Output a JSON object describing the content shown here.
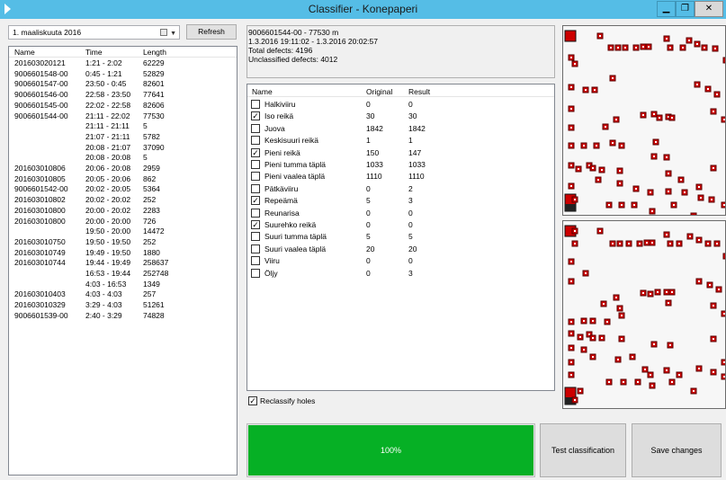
{
  "window": {
    "title": "Classifier - Konepaperi"
  },
  "controls": {
    "minimize": "▁",
    "maximize": "❐",
    "close": "✕",
    "date_value": "1. maaliskuuta 2016",
    "refresh_label": "Refresh"
  },
  "sessions": {
    "headers": {
      "name": "Name",
      "time": "Time",
      "length": "Length"
    },
    "rows": [
      {
        "name": "201603020121",
        "time": "1:21 - 2:02",
        "length": "62229"
      },
      {
        "name": "9006601548-00",
        "time": "0:45 - 1:21",
        "length": "52829"
      },
      {
        "name": "9006601547-00",
        "time": "23:50 - 0:45",
        "length": "82601"
      },
      {
        "name": "9006601546-00",
        "time": "22:58 - 23:50",
        "length": "77641"
      },
      {
        "name": "9006601545-00",
        "time": "22:02 - 22:58",
        "length": "82606"
      },
      {
        "name": "9006601544-00",
        "time": "21:11 - 22:02",
        "length": "77530"
      },
      {
        "name": "",
        "time": "21:11 - 21:11",
        "length": "5"
      },
      {
        "name": "",
        "time": "21:07 - 21:11",
        "length": "5782"
      },
      {
        "name": "",
        "time": "20:08 - 21:07",
        "length": "37090"
      },
      {
        "name": "",
        "time": "20:08 - 20:08",
        "length": "5"
      },
      {
        "name": "201603010806",
        "time": "20:06 - 20:08",
        "length": "2959"
      },
      {
        "name": "201603010805",
        "time": "20:05 - 20:06",
        "length": "862"
      },
      {
        "name": "9006601542-00",
        "time": "20:02 - 20:05",
        "length": "5364"
      },
      {
        "name": "201603010802",
        "time": "20:02 - 20:02",
        "length": "252"
      },
      {
        "name": "201603010800",
        "time": "20:00 - 20:02",
        "length": "2283"
      },
      {
        "name": "201603010800",
        "time": "20:00 - 20:00",
        "length": "726"
      },
      {
        "name": "",
        "time": "19:50 - 20:00",
        "length": "14472"
      },
      {
        "name": "201603010750",
        "time": "19:50 - 19:50",
        "length": "252"
      },
      {
        "name": "201603010749",
        "time": "19:49 - 19:50",
        "length": "1880"
      },
      {
        "name": "201603010744",
        "time": "19:44 - 19:49",
        "length": "258637"
      },
      {
        "name": "",
        "time": "16:53 - 19:44",
        "length": "252748"
      },
      {
        "name": "",
        "time": "4:03 - 16:53",
        "length": "1349"
      },
      {
        "name": "201603010403",
        "time": "4:03 - 4:03",
        "length": "257"
      },
      {
        "name": "201603010329",
        "time": "3:29 - 4:03",
        "length": "51261"
      },
      {
        "name": "9006601539-00",
        "time": "2:40 - 3:29",
        "length": "74828"
      }
    ]
  },
  "info": {
    "line1": "9006601544-00 - 77530 m",
    "line2": "1.3.2016 19:11:02 - 1.3.2016 20:02:57",
    "line3": "Total defects: 4196",
    "line4": "Unclassified defects: 4012"
  },
  "defects": {
    "headers": {
      "name": "Name",
      "original": "Original",
      "result": "Result"
    },
    "rows": [
      {
        "name": "Halkiviiru",
        "original": "0",
        "result": "0",
        "checked": false
      },
      {
        "name": "Iso reikä",
        "original": "30",
        "result": "30",
        "checked": true
      },
      {
        "name": "Juova",
        "original": "1842",
        "result": "1842",
        "checked": false
      },
      {
        "name": "Keskisuuri reikä",
        "original": "1",
        "result": "1",
        "checked": false
      },
      {
        "name": "Pieni reikä",
        "original": "150",
        "result": "147",
        "checked": true
      },
      {
        "name": "Pieni tumma täplä",
        "original": "1033",
        "result": "1033",
        "checked": false
      },
      {
        "name": "Pieni vaalea täplä",
        "original": "1110",
        "result": "1110",
        "checked": false
      },
      {
        "name": "Pätkäviiru",
        "original": "0",
        "result": "2",
        "checked": false
      },
      {
        "name": "Repeämä",
        "original": "5",
        "result": "3",
        "checked": true
      },
      {
        "name": "Reunarisa",
        "original": "0",
        "result": "0",
        "checked": false
      },
      {
        "name": "Suurehko reikä",
        "original": "0",
        "result": "0",
        "checked": true
      },
      {
        "name": "Suuri tumma täplä",
        "original": "5",
        "result": "5",
        "checked": false
      },
      {
        "name": "Suuri vaalea täplä",
        "original": "20",
        "result": "20",
        "checked": false
      },
      {
        "name": "Viiru",
        "original": "0",
        "result": "0",
        "checked": false
      },
      {
        "name": "Öljy",
        "original": "0",
        "result": "3",
        "checked": false
      }
    ]
  },
  "reclassify": {
    "label": "Reclassify holes",
    "checked": true
  },
  "progress": {
    "value": 1.0,
    "text": "100%"
  },
  "buttons": {
    "test": "Test classification",
    "save": "Save changes"
  },
  "colors": {
    "titlebar": "#55bde6",
    "progress": "#06b025",
    "marker_fill": "#cc0000",
    "marker_border": "#5a0000"
  }
}
